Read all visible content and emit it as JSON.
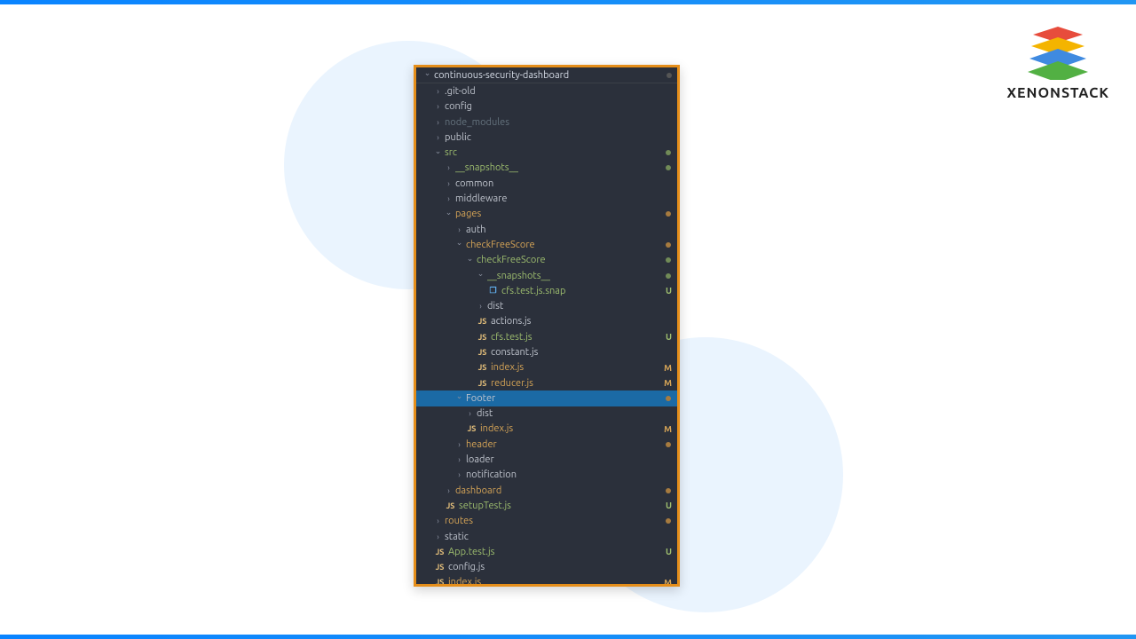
{
  "brand": "XENONSTACK",
  "tree": [
    {
      "label": "continuous-security-dashboard",
      "indent": 0,
      "chevron": "down",
      "iconType": "",
      "color": "",
      "status": "dot-root",
      "root": true
    },
    {
      "label": ".git-old",
      "indent": 1,
      "chevron": "right",
      "iconType": "",
      "color": "",
      "status": ""
    },
    {
      "label": "config",
      "indent": 1,
      "chevron": "right",
      "iconType": "",
      "color": "",
      "status": ""
    },
    {
      "label": "node_modules",
      "indent": 1,
      "chevron": "right",
      "iconType": "",
      "color": "grey",
      "status": ""
    },
    {
      "label": "public",
      "indent": 1,
      "chevron": "right",
      "iconType": "",
      "color": "",
      "status": ""
    },
    {
      "label": "src",
      "indent": 1,
      "chevron": "down",
      "iconType": "",
      "color": "green",
      "status": "dot-grn"
    },
    {
      "label": "__snapshots__",
      "indent": 2,
      "chevron": "right",
      "iconType": "",
      "color": "green",
      "status": "dot-grn"
    },
    {
      "label": "common",
      "indent": 2,
      "chevron": "right",
      "iconType": "",
      "color": "",
      "status": ""
    },
    {
      "label": "middleware",
      "indent": 2,
      "chevron": "right",
      "iconType": "",
      "color": "",
      "status": ""
    },
    {
      "label": "pages",
      "indent": 2,
      "chevron": "down",
      "iconType": "",
      "color": "orange",
      "status": "dot-org"
    },
    {
      "label": "auth",
      "indent": 3,
      "chevron": "right",
      "iconType": "",
      "color": "",
      "status": ""
    },
    {
      "label": "checkFreeScore",
      "indent": 3,
      "chevron": "down",
      "iconType": "",
      "color": "orange",
      "status": "dot-org"
    },
    {
      "label": "checkFreeScore",
      "indent": 4,
      "chevron": "down",
      "iconType": "",
      "color": "green",
      "status": "dot-grn"
    },
    {
      "label": "__snapshots__",
      "indent": 5,
      "chevron": "down",
      "iconType": "",
      "color": "green",
      "status": "dot-grn"
    },
    {
      "label": "cfs.test.js.snap",
      "indent": 6,
      "chevron": "",
      "iconType": "snap",
      "color": "green",
      "status": "U"
    },
    {
      "label": "dist",
      "indent": 5,
      "chevron": "right",
      "iconType": "",
      "color": "",
      "status": ""
    },
    {
      "label": "actions.js",
      "indent": 5,
      "chevron": "",
      "iconType": "js",
      "color": "",
      "status": ""
    },
    {
      "label": "cfs.test.js",
      "indent": 5,
      "chevron": "",
      "iconType": "js",
      "color": "green",
      "status": "U"
    },
    {
      "label": "constant.js",
      "indent": 5,
      "chevron": "",
      "iconType": "js",
      "color": "",
      "status": ""
    },
    {
      "label": "index.js",
      "indent": 5,
      "chevron": "",
      "iconType": "js",
      "color": "orange",
      "status": "M"
    },
    {
      "label": "reducer.js",
      "indent": 5,
      "chevron": "",
      "iconType": "js",
      "color": "orange",
      "status": "M"
    },
    {
      "label": "Footer",
      "indent": 3,
      "chevron": "down",
      "iconType": "",
      "color": "",
      "status": "dot-org",
      "selected": true
    },
    {
      "label": "dist",
      "indent": 4,
      "chevron": "right",
      "iconType": "",
      "color": "",
      "status": ""
    },
    {
      "label": "index.js",
      "indent": 4,
      "chevron": "",
      "iconType": "js",
      "color": "orange",
      "status": "M"
    },
    {
      "label": "header",
      "indent": 3,
      "chevron": "right",
      "iconType": "",
      "color": "orange",
      "status": "dot-org"
    },
    {
      "label": "loader",
      "indent": 3,
      "chevron": "right",
      "iconType": "",
      "color": "",
      "status": ""
    },
    {
      "label": "notification",
      "indent": 3,
      "chevron": "right",
      "iconType": "",
      "color": "",
      "status": ""
    },
    {
      "label": "dashboard",
      "indent": 2,
      "chevron": "right",
      "iconType": "",
      "color": "orange",
      "status": "dot-org"
    },
    {
      "label": "setupTest.js",
      "indent": 2,
      "chevron": "",
      "iconType": "js",
      "color": "green",
      "status": "U"
    },
    {
      "label": "routes",
      "indent": 1,
      "chevron": "right",
      "iconType": "",
      "color": "orange",
      "status": "dot-org"
    },
    {
      "label": "static",
      "indent": 1,
      "chevron": "right",
      "iconType": "",
      "color": "",
      "status": ""
    },
    {
      "label": "App.test.js",
      "indent": 1,
      "chevron": "",
      "iconType": "js",
      "color": "green",
      "status": "U"
    },
    {
      "label": "config.js",
      "indent": 1,
      "chevron": "",
      "iconType": "js",
      "color": "",
      "status": ""
    },
    {
      "label": "index.js",
      "indent": 1,
      "chevron": "",
      "iconType": "js",
      "color": "orange",
      "status": "M"
    }
  ]
}
